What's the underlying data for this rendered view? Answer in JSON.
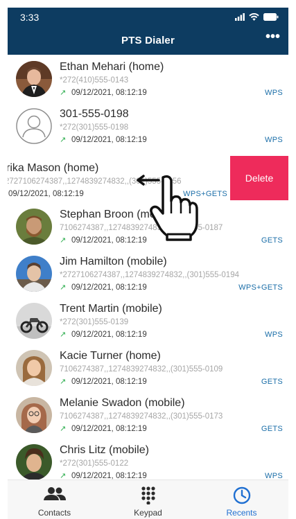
{
  "status": {
    "time": "3:33"
  },
  "header": {
    "title": "PTS Dialer",
    "more_label": "•••"
  },
  "recents": [
    {
      "name": "Ethan Mehari (home)",
      "number": "*272(410)555-0143",
      "datetime": "09/12/2021, 08:12:19",
      "tag": "WPS"
    },
    {
      "name": "301-555-0198",
      "number": "*272(301)555-0198",
      "datetime": "09/12/2021, 08:12:19",
      "tag": "WPS"
    },
    {
      "name": "rika Mason (home)",
      "number": "2727106274387,,1274839274832,,(301)555-0156",
      "datetime": "09/12/2021, 08:12:19",
      "tag": "WPS+GETS",
      "delete_label": "Delete"
    },
    {
      "name": "Stephan Broon (mobile)",
      "number": "7106274387,,1274839274832,,(301)555-0187",
      "datetime": "09/12/2021, 08:12:19",
      "tag": "GETS"
    },
    {
      "name": "Jim Hamilton (mobile)",
      "number": "*2727106274387,,1274839274832,,(301)555-0194",
      "datetime": "09/12/2021, 08:12:19",
      "tag": "WPS+GETS"
    },
    {
      "name": "Trent Martin (mobile)",
      "number": "*272(301)555-0139",
      "datetime": "09/12/2021, 08:12:19",
      "tag": "WPS"
    },
    {
      "name": "Kacie Turner (home)",
      "number": "7106274387,,1274839274832,,(301)555-0109",
      "datetime": "09/12/2021, 08:12:19",
      "tag": "GETS"
    },
    {
      "name": "Melanie Swadon (mobile)",
      "number": "7106274387,,1274839274832,,(301)555-0173",
      "datetime": "09/12/2021, 08:12:19",
      "tag": "GETS"
    },
    {
      "name": "Chris Litz (mobile)",
      "number": "*272(301)555-0122",
      "datetime": "09/12/2021, 08:12:19",
      "tag": "WPS"
    }
  ],
  "tabs": [
    {
      "label": "Contacts",
      "icon": "contacts-icon"
    },
    {
      "label": "Keypad",
      "icon": "keypad-icon"
    },
    {
      "label": "Recents",
      "icon": "clock-icon"
    }
  ],
  "colors": {
    "header": "#0d3c61",
    "delete": "#ee2b5b",
    "tag": "#1b6ea8",
    "active_tab": "#1f6fd1",
    "outgoing_arrow": "#2eae4f"
  }
}
